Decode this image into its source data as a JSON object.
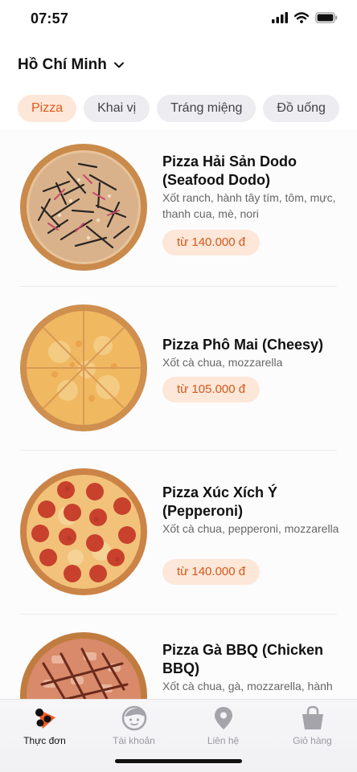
{
  "status": {
    "time": "07:57"
  },
  "header": {
    "city": "Hồ Chí Minh"
  },
  "tabs": [
    {
      "label": "Pizza",
      "active": true
    },
    {
      "label": "Khai vị",
      "active": false
    },
    {
      "label": "Tráng miệng",
      "active": false
    },
    {
      "label": "Đồ uống",
      "active": false
    }
  ],
  "products": [
    {
      "name": "Pizza Hải Sản Dodo (Seafood Dodo)",
      "description": "Xốt ranch, hành tây tím, tôm, mực, thanh cua, mè, nori",
      "price": "từ 140.000 đ"
    },
    {
      "name": "Pizza Phô Mai (Cheesy)",
      "description": "Xốt cà chua, mozzarella",
      "price": "từ 105.000 đ"
    },
    {
      "name": "Pizza Xúc Xích Ý (Pepperoni)",
      "description": "Xốt cà chua, pepperoni, mozzarella",
      "price": "từ 140.000 đ"
    },
    {
      "name": "Pizza Gà BBQ (Chicken BBQ)",
      "description": "Xốt cà chua, gà, mozzarella, hành",
      "price": ""
    }
  ],
  "nav": [
    {
      "label": "Thực đơn",
      "icon": "menu-pizza-icon",
      "active": true
    },
    {
      "label": "Tài khoản",
      "icon": "account-face-icon",
      "active": false
    },
    {
      "label": "Liên hệ",
      "icon": "location-pin-icon",
      "active": false
    },
    {
      "label": "Giỏ hàng",
      "icon": "shopping-bag-icon",
      "active": false
    }
  ],
  "colors": {
    "accent": "#e0581a",
    "accent_bg": "#fde7d8",
    "tab_bg": "#ececf1",
    "nav_inactive": "#9a9aa0"
  }
}
